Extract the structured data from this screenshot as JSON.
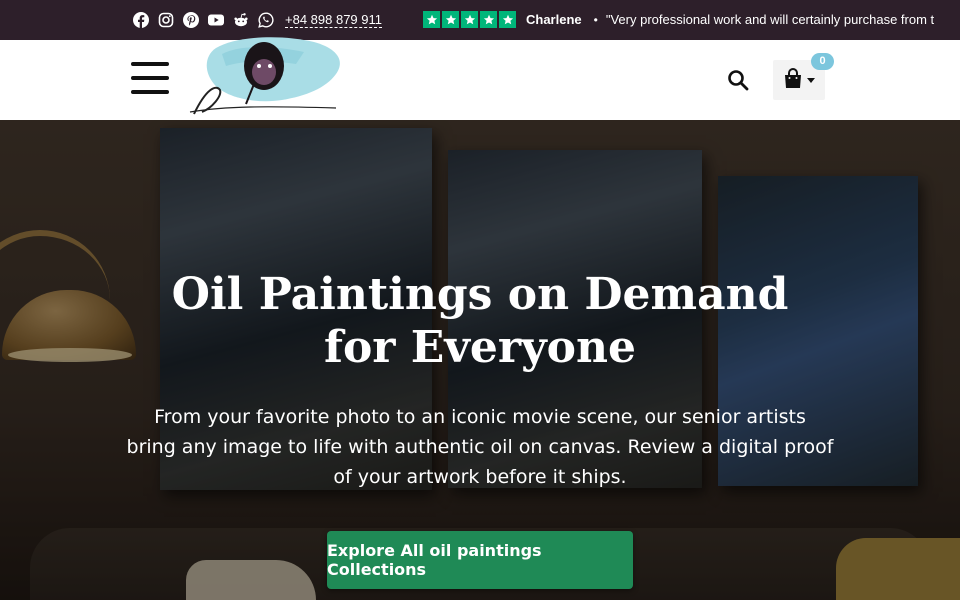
{
  "topbar": {
    "social_icons": [
      "facebook-icon",
      "instagram-icon",
      "pinterest-icon",
      "youtube-icon",
      "reddit-icon",
      "whatsapp-icon"
    ],
    "phone": "+84 898 879 911",
    "trustpilot": {
      "stars": 5,
      "star_color": "#00b67a",
      "reviewer": "Charlene",
      "separator": "•",
      "quote": "\"Very professional work and will certainly purchase from t"
    },
    "background": "#2d1f2a"
  },
  "header": {
    "menu_icon": "hamburger-icon",
    "logo_text": "Artist monkeys",
    "search_icon": "search-icon",
    "cart": {
      "icon": "shopping-bag-icon",
      "count": "0",
      "badge_color": "#7cc6dd"
    }
  },
  "hero": {
    "title_line1": "Oil Paintings on Demand",
    "title_line2": "for Everyone",
    "subtitle_line1": "From your favorite photo to an iconic movie scene, our senior artists",
    "subtitle_line2": "bring any image to life with authentic oil on canvas. Review a digital proof",
    "subtitle_line3": "of your artwork before it ships.",
    "cta_label": "Explore All oil paintings Collections",
    "cta_color": "#1f8a56"
  }
}
